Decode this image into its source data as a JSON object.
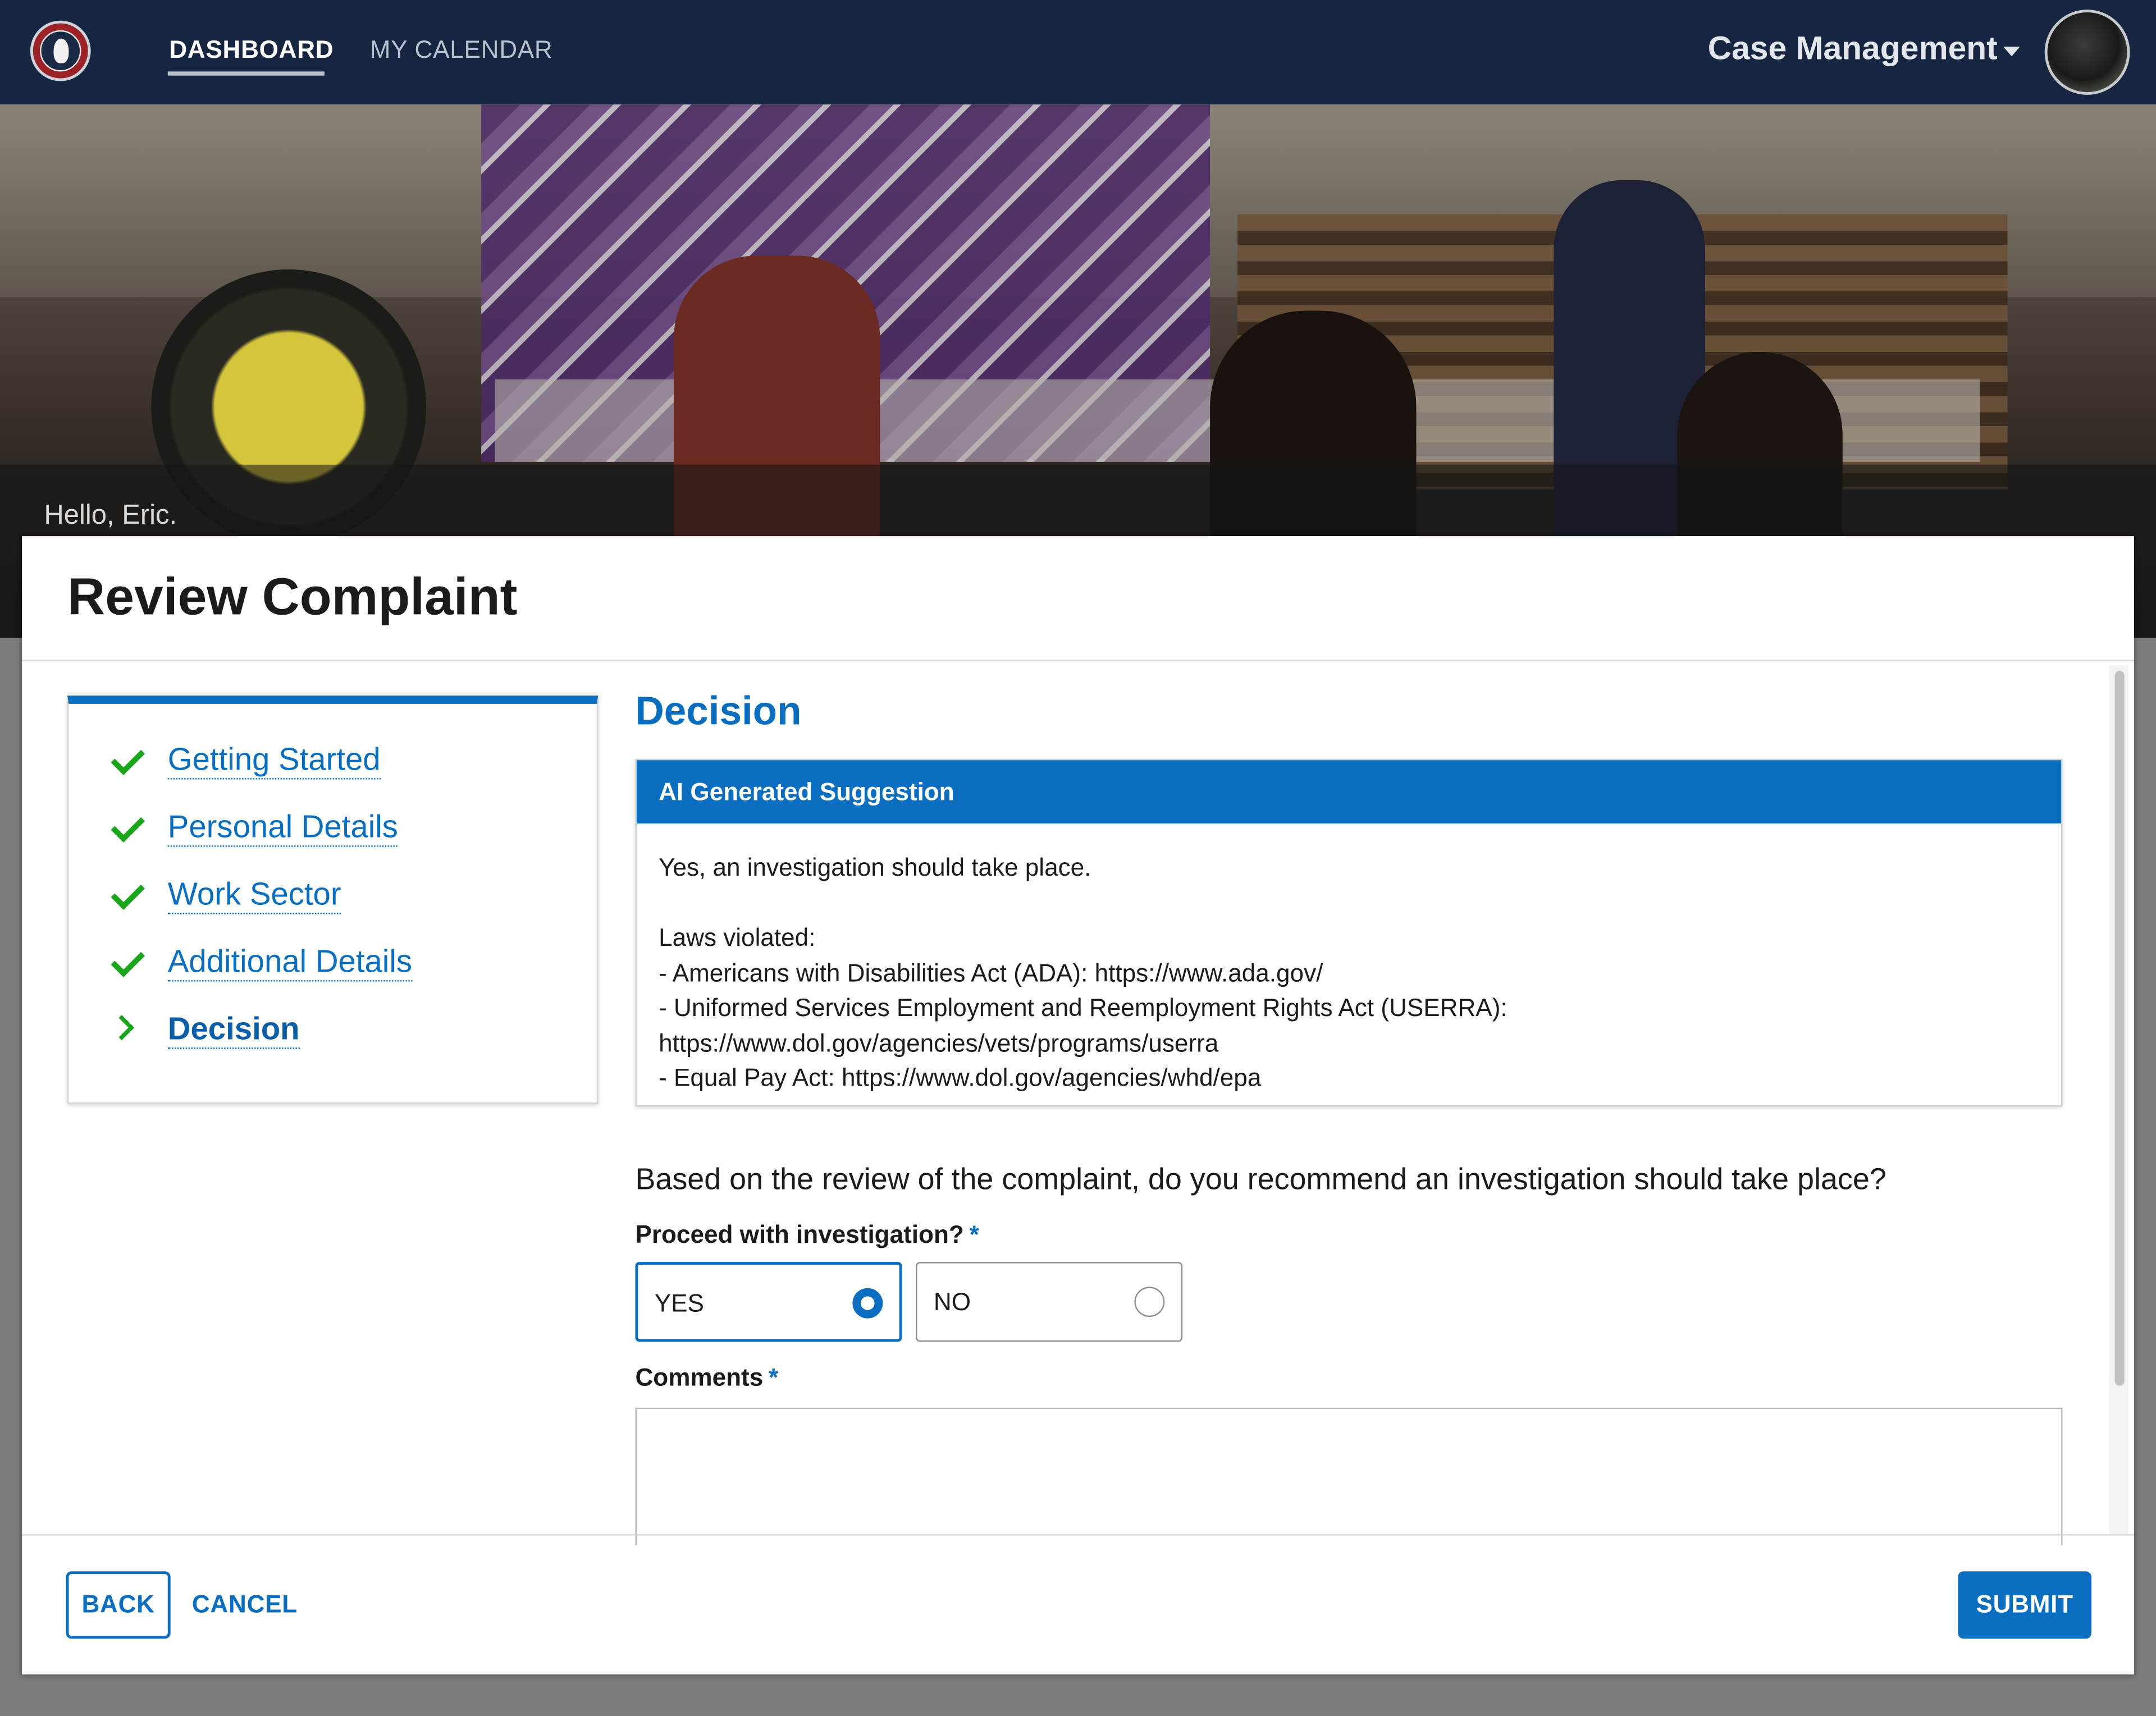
{
  "nav": {
    "links": [
      "DASHBOARD",
      "MY CALENDAR"
    ],
    "app_menu": "Case Management"
  },
  "hero": {
    "greeting": "Hello, Eric."
  },
  "modal": {
    "title": "Review Complaint",
    "steps": [
      {
        "label": "Getting Started",
        "status": "complete"
      },
      {
        "label": "Personal Details",
        "status": "complete"
      },
      {
        "label": "Work Sector",
        "status": "complete"
      },
      {
        "label": "Additional Details",
        "status": "complete"
      },
      {
        "label": "Decision",
        "status": "current"
      }
    ],
    "section_heading": "Decision",
    "ai_box": {
      "title": "AI Generated Suggestion",
      "body": "Yes, an investigation should take place.\n\nLaws violated:\n- Americans with Disabilities Act (ADA): https://www.ada.gov/\n- Uniformed Services Employment and Reemployment Rights Act (USERRA):\nhttps://www.dol.gov/agencies/vets/programs/userra\n- Equal Pay Act: https://www.dol.gov/agencies/whd/epa"
    },
    "question": "Based on the review of the complaint, do you recommend an investigation should take place?",
    "proceed_label": "Proceed with investigation?",
    "required_mark": "*",
    "options": [
      {
        "label": "YES",
        "selected": true
      },
      {
        "label": "NO",
        "selected": false
      }
    ],
    "comments_label": "Comments",
    "comments_value": "",
    "buttons": {
      "back": "BACK",
      "cancel": "CANCEL",
      "submit": "SUBMIT"
    }
  },
  "colors": {
    "nav_bg": "#162540",
    "primary": "#0a6ec0",
    "check": "#1aa51a"
  },
  "icons": [
    "agency-logo-icon",
    "caret-down-icon",
    "user-avatar",
    "check-icon",
    "chevron-right-icon",
    "radio-icon"
  ]
}
